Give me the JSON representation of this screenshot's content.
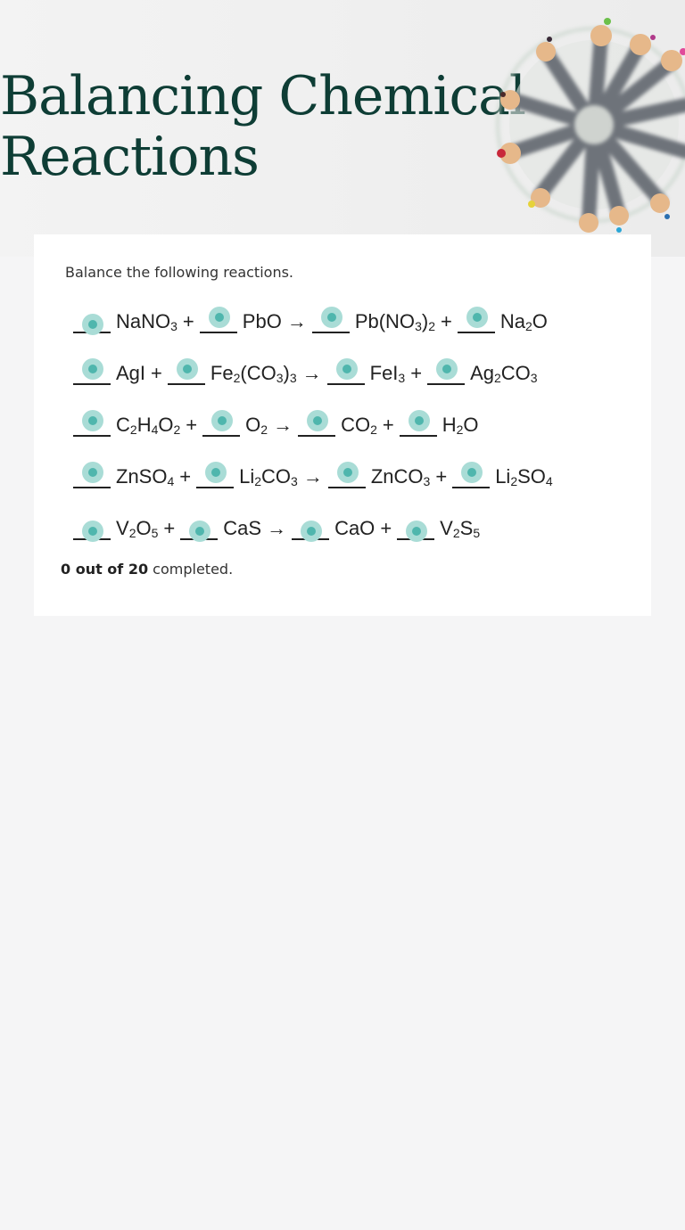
{
  "header": {
    "title_line1": "Balancing Chemical",
    "title_line2": "Reactions",
    "image": "pencils-in-cup-photo"
  },
  "worksheet": {
    "instructions": "Balance the following reactions.",
    "arrow": "→",
    "plus": "+",
    "reactions": [
      {
        "reactants": [
          {
            "base": "NaNO",
            "parts": [
              [
                "NaNO",
                ""
              ],
              [
                "",
                "3"
              ]
            ]
          },
          {
            "parts": [
              [
                "PbO",
                ""
              ]
            ]
          }
        ],
        "products": [
          {
            "parts": [
              [
                "Pb(NO",
                ""
              ],
              [
                "",
                "3"
              ],
              [
                ")",
                ""
              ],
              [
                "",
                "2"
              ]
            ]
          },
          {
            "parts": [
              [
                "Na",
                ""
              ],
              [
                "",
                "2"
              ],
              [
                "O",
                ""
              ]
            ]
          }
        ]
      },
      {
        "reactants": [
          {
            "parts": [
              [
                "AgI",
                ""
              ]
            ]
          },
          {
            "parts": [
              [
                "Fe",
                ""
              ],
              [
                "",
                "2"
              ],
              [
                "(CO",
                ""
              ],
              [
                "",
                "3"
              ],
              [
                ")",
                ""
              ],
              [
                "",
                "3"
              ]
            ]
          }
        ],
        "products": [
          {
            "parts": [
              [
                "FeI",
                ""
              ],
              [
                "",
                "3"
              ]
            ]
          },
          {
            "parts": [
              [
                "Ag",
                ""
              ],
              [
                "",
                "2"
              ],
              [
                "CO",
                ""
              ],
              [
                "",
                "3"
              ]
            ]
          }
        ]
      },
      {
        "reactants": [
          {
            "parts": [
              [
                "C",
                ""
              ],
              [
                "",
                "2"
              ],
              [
                "H",
                ""
              ],
              [
                "",
                "4"
              ],
              [
                "O",
                ""
              ],
              [
                "",
                "2"
              ]
            ]
          },
          {
            "parts": [
              [
                "O",
                ""
              ],
              [
                "",
                "2"
              ]
            ]
          }
        ],
        "products": [
          {
            "parts": [
              [
                "CO",
                ""
              ],
              [
                "",
                "2"
              ]
            ]
          },
          {
            "parts": [
              [
                "H",
                ""
              ],
              [
                "",
                "2"
              ],
              [
                "O",
                ""
              ]
            ]
          }
        ]
      },
      {
        "reactants": [
          {
            "parts": [
              [
                "ZnSO",
                ""
              ],
              [
                "",
                "4"
              ]
            ]
          },
          {
            "parts": [
              [
                "Li",
                ""
              ],
              [
                "",
                "2"
              ],
              [
                "CO",
                ""
              ],
              [
                "",
                "3"
              ]
            ]
          }
        ],
        "products": [
          {
            "parts": [
              [
                "ZnCO",
                ""
              ],
              [
                "",
                "3"
              ]
            ]
          },
          {
            "parts": [
              [
                "Li",
                ""
              ],
              [
                "",
                "2"
              ],
              [
                "SO",
                ""
              ],
              [
                "",
                "4"
              ]
            ]
          }
        ]
      },
      {
        "reactants": [
          {
            "parts": [
              [
                "V",
                ""
              ],
              [
                "",
                "2"
              ],
              [
                "O",
                ""
              ],
              [
                "",
                "5"
              ]
            ]
          },
          {
            "parts": [
              [
                "CaS",
                ""
              ]
            ]
          }
        ],
        "products": [
          {
            "parts": [
              [
                "CaO",
                ""
              ]
            ]
          },
          {
            "parts": [
              [
                "V",
                ""
              ],
              [
                "",
                "2"
              ],
              [
                "S",
                ""
              ],
              [
                "",
                "5"
              ]
            ]
          }
        ]
      }
    ],
    "formulas_text": [
      [
        "NaNO3",
        "PbO",
        "Pb(NO3)2",
        "Na2O"
      ],
      [
        "AgI",
        "Fe2(CO3)3",
        "FeI3",
        "Ag2CO3"
      ],
      [
        "C2H4O2",
        "O2",
        "CO2",
        "H2O"
      ],
      [
        "ZnSO4",
        "Li2CO3",
        "ZnCO3",
        "Li2SO4"
      ],
      [
        "V2O5",
        "CaS",
        "CaO",
        "V2S5"
      ]
    ],
    "blank_values": [
      "",
      "",
      "",
      ""
    ],
    "status": {
      "count_text": "0 out of 20",
      "suffix": " completed."
    }
  },
  "colors": {
    "title": "#0e3d35",
    "radio_outer": "#a9dcd6",
    "radio_inner": "#4fb6ad",
    "page_bg": "#f5f5f6"
  }
}
